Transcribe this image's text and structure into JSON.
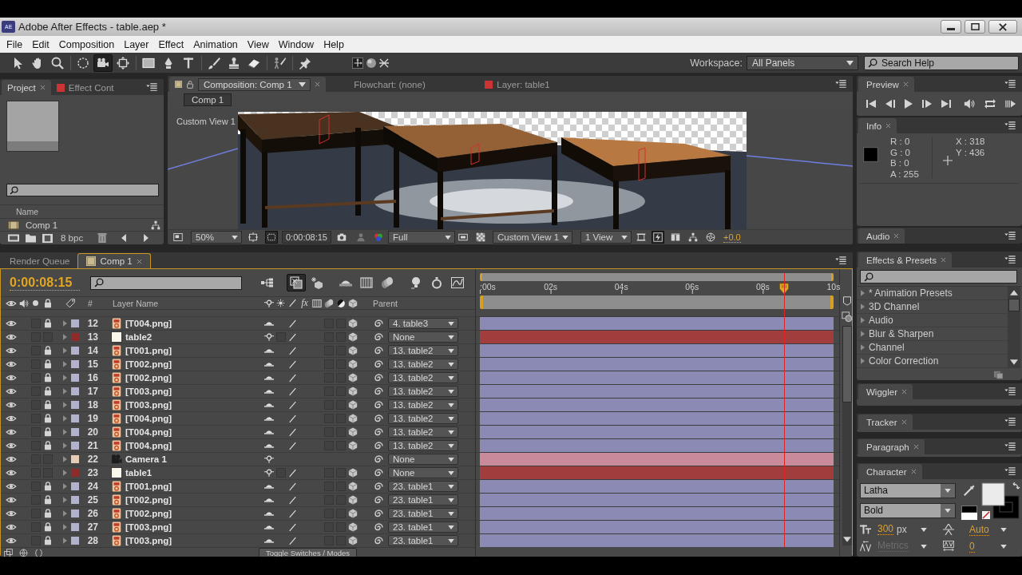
{
  "window": {
    "logo": "AE",
    "title": "Adobe After Effects - table.aep *"
  },
  "menu": [
    "File",
    "Edit",
    "Composition",
    "Layer",
    "Effect",
    "Animation",
    "View",
    "Window",
    "Help"
  ],
  "toolbar": {
    "tools": [
      {
        "kind": "selection",
        "selected": false
      },
      {
        "kind": "hand",
        "selected": false
      },
      {
        "kind": "zoom",
        "selected": false
      },
      {
        "kind": "rotation",
        "selected": false
      },
      {
        "kind": "orbit",
        "selected": true
      },
      {
        "kind": "pan",
        "selected": false
      },
      {
        "kind": "rectangle",
        "selected": false
      },
      {
        "kind": "pen",
        "selected": false
      },
      {
        "kind": "type",
        "selected": false
      },
      {
        "kind": "brush",
        "selected": false
      },
      {
        "kind": "stamp",
        "selected": false
      },
      {
        "kind": "eraser",
        "selected": false
      },
      {
        "kind": "roto",
        "selected": false
      },
      {
        "kind": "pin",
        "selected": false
      }
    ],
    "workspace_label": "Workspace:",
    "workspace": "All Panels",
    "search": {
      "placeholder": "Search Help"
    }
  },
  "project_panel": {
    "tabs": [
      {
        "kind": "project",
        "label": "Project",
        "selected": true
      },
      {
        "kind": "effect_controls",
        "label": "Effect Cont",
        "selected": false
      }
    ],
    "column": "Name",
    "items": [
      "Comp 1"
    ],
    "bit_depth": "8 bpc"
  },
  "composition_panel": {
    "tabs": [
      {
        "kind": "composition",
        "label": "Composition: Comp 1",
        "selected": true
      },
      {
        "kind": "flowchart",
        "label": "Flowchart: (none)",
        "selected": false
      },
      {
        "kind": "layer",
        "label": "Layer: table1",
        "selected": false
      }
    ],
    "breadcrumb": "Comp 1",
    "view_name": "Custom View 1",
    "controls": [
      {
        "kind": "region",
        "on": false
      },
      {
        "kind": "zoom",
        "value": "50%"
      },
      {
        "kind": "fit",
        "on": false
      },
      {
        "kind": "mask",
        "on": true
      },
      {
        "kind": "timecode",
        "value": "0:00:08:15"
      },
      {
        "kind": "snapshot",
        "on": false
      },
      {
        "kind": "show_snapshot",
        "on": false
      },
      {
        "kind": "channels",
        "on": false
      },
      {
        "kind": "resolution",
        "value": "Full"
      },
      {
        "kind": "roi",
        "on": false
      },
      {
        "kind": "transparency",
        "on": false
      },
      {
        "kind": "view",
        "value": "Custom View 1"
      },
      {
        "kind": "layout",
        "value": "1 View"
      },
      {
        "kind": "pixel_aspect",
        "on": false
      },
      {
        "kind": "fast_previews",
        "on": true
      },
      {
        "kind": "timeline",
        "on": false
      },
      {
        "kind": "flowchart",
        "on": false
      },
      {
        "kind": "exposure_reset",
        "on": false
      },
      {
        "kind": "exposure",
        "value": "+0.0"
      }
    ]
  },
  "preview_panel": {
    "title": "Preview"
  },
  "info_panel": {
    "title": "Info",
    "color_values": [
      "R : 0",
      "G : 0",
      "B : 0",
      "A : 255"
    ],
    "position": [
      "X : 318",
      "Y : 436"
    ]
  },
  "audio_panel": {
    "title": "Audio"
  },
  "timeline": {
    "tabs": [
      {
        "kind": "render_queue",
        "label": "Render Queue",
        "selected": false
      },
      {
        "kind": "composition",
        "label": "Comp 1",
        "selected": true
      }
    ],
    "current_time": "0:00:08:15",
    "buttons": [
      {
        "kind": "flowchart",
        "on": false
      },
      {
        "kind": "draft3d",
        "on": true
      },
      {
        "kind": "lights",
        "on": false
      },
      {
        "kind": "shy",
        "on": false
      },
      {
        "kind": "frameblend",
        "on": false
      },
      {
        "kind": "motionblur",
        "on": false
      },
      {
        "kind": "brainstorm",
        "on": false
      },
      {
        "kind": "autokey",
        "on": false
      },
      {
        "kind": "graph",
        "on": false
      }
    ],
    "columns": {
      "number": "#",
      "name": "Layer Name",
      "effects": "fx",
      "parent": "Parent"
    },
    "ruler": {
      "labels": [
        ":00s",
        "02s",
        "04s",
        "06s",
        "08s",
        "10s"
      ],
      "level": 0.86
    },
    "layers": [
      {
        "number": "12",
        "name": "[T004.png]",
        "kind": "image",
        "color": "#b2b2cc",
        "solo": false,
        "locked": true,
        "expanded": false,
        "motion_blur": false,
        "adjustment": false,
        "parent": "4. table3"
      },
      {
        "number": "13",
        "name": "table2",
        "kind": "solid",
        "color": "#8e2c2c",
        "solo": false,
        "locked": false,
        "expanded": false,
        "rasterize": false,
        "motion_blur": false,
        "adjustment": false,
        "parent": "None"
      },
      {
        "number": "14",
        "name": "[T001.png]",
        "kind": "image",
        "color": "#b2b2cc",
        "solo": false,
        "locked": true,
        "expanded": false,
        "motion_blur": false,
        "adjustment": false,
        "parent": "13. table2"
      },
      {
        "number": "15",
        "name": "[T002.png]",
        "kind": "image",
        "color": "#b2b2cc",
        "solo": false,
        "locked": true,
        "expanded": false,
        "motion_blur": false,
        "adjustment": false,
        "parent": "13. table2"
      },
      {
        "number": "16",
        "name": "[T002.png]",
        "kind": "image",
        "color": "#b2b2cc",
        "solo": false,
        "locked": true,
        "expanded": false,
        "motion_blur": false,
        "adjustment": false,
        "parent": "13. table2"
      },
      {
        "number": "17",
        "name": "[T003.png]",
        "kind": "image",
        "color": "#b2b2cc",
        "solo": false,
        "locked": true,
        "expanded": false,
        "motion_blur": false,
        "adjustment": false,
        "parent": "13. table2"
      },
      {
        "number": "18",
        "name": "[T003.png]",
        "kind": "image",
        "color": "#b2b2cc",
        "solo": false,
        "locked": true,
        "expanded": false,
        "motion_blur": false,
        "adjustment": false,
        "parent": "13. table2"
      },
      {
        "number": "19",
        "name": "[T004.png]",
        "kind": "image",
        "color": "#b2b2cc",
        "solo": false,
        "locked": true,
        "expanded": false,
        "motion_blur": false,
        "adjustment": false,
        "parent": "13. table2"
      },
      {
        "number": "20",
        "name": "[T004.png]",
        "kind": "image",
        "color": "#b2b2cc",
        "solo": false,
        "locked": true,
        "expanded": false,
        "motion_blur": false,
        "adjustment": false,
        "parent": "13. table2"
      },
      {
        "number": "21",
        "name": "[T004.png]",
        "kind": "image",
        "color": "#b2b2cc",
        "solo": false,
        "locked": true,
        "expanded": false,
        "motion_blur": false,
        "adjustment": false,
        "parent": "13. table2"
      },
      {
        "number": "22",
        "name": "Camera 1",
        "kind": "camera",
        "color": "#e4ccb6",
        "solo": false,
        "locked": false,
        "expanded": false,
        "parent": "None"
      },
      {
        "number": "23",
        "name": "table1",
        "kind": "solid",
        "color": "#8e2c2c",
        "solo": false,
        "locked": false,
        "expanded": false,
        "rasterize": false,
        "motion_blur": false,
        "adjustment": false,
        "parent": "None"
      },
      {
        "number": "24",
        "name": "[T001.png]",
        "kind": "image",
        "color": "#b2b2cc",
        "solo": false,
        "locked": true,
        "expanded": false,
        "motion_blur": false,
        "adjustment": false,
        "parent": "23. table1"
      },
      {
        "number": "25",
        "name": "[T002.png]",
        "kind": "image",
        "color": "#b2b2cc",
        "solo": false,
        "locked": true,
        "expanded": false,
        "motion_blur": false,
        "adjustment": false,
        "parent": "23. table1"
      },
      {
        "number": "26",
        "name": "[T002.png]",
        "kind": "image",
        "color": "#b2b2cc",
        "solo": false,
        "locked": true,
        "expanded": false,
        "motion_blur": false,
        "adjustment": false,
        "parent": "23. table1"
      },
      {
        "number": "27",
        "name": "[T003.png]",
        "kind": "image",
        "color": "#b2b2cc",
        "solo": false,
        "locked": true,
        "expanded": false,
        "motion_blur": false,
        "adjustment": false,
        "parent": "23. table1"
      },
      {
        "number": "28",
        "name": "[T003.png]",
        "kind": "image",
        "color": "#b2b2cc",
        "solo": false,
        "locked": true,
        "expanded": false,
        "motion_blur": false,
        "adjustment": false,
        "parent": "23. table1"
      }
    ],
    "toggle_button": "Toggle Switches / Modes"
  },
  "effects_presets": {
    "title": "Effects & Presets",
    "categories": [
      {
        "label": "* Animation Presets",
        "expanded": false
      },
      {
        "label": "3D Channel",
        "expanded": false
      },
      {
        "label": "Audio",
        "expanded": false
      },
      {
        "label": "Blur & Sharpen",
        "expanded": false
      },
      {
        "label": "Channel",
        "expanded": false
      },
      {
        "label": "Color Correction",
        "expanded": false
      }
    ]
  },
  "wiggler_panel": {
    "title": "Wiggler"
  },
  "tracker_panel": {
    "title": "Tracker"
  },
  "paragraph_panel": {
    "title": "Paragraph"
  },
  "character_panel": {
    "title": "Character",
    "font": "Latha",
    "style": "Bold",
    "size": "300",
    "size_unit": "px",
    "leading": "Auto",
    "kerning": {
      "value": "Metrics",
      "disabled": true
    },
    "tracking": "0"
  }
}
